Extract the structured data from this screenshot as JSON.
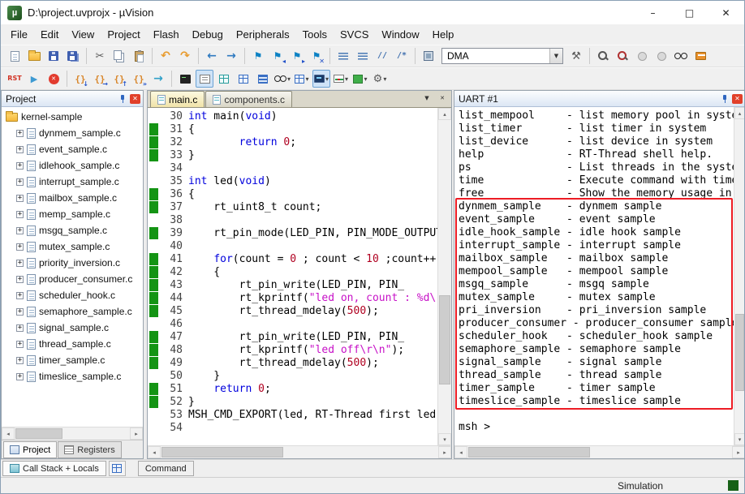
{
  "window": {
    "title": "D:\\project.uvprojx - µVision"
  },
  "menu": {
    "items": [
      "File",
      "Edit",
      "View",
      "Project",
      "Flash",
      "Debug",
      "Peripherals",
      "Tools",
      "SVCS",
      "Window",
      "Help"
    ]
  },
  "icons": {
    "app_logo": "µ",
    "minimize": "–",
    "maximize": "□",
    "close": "✕",
    "dropdown": "▼",
    "dropdown_small": "▾",
    "expander": "+",
    "scroll_left": "◂",
    "scroll_right": "▸",
    "scroll_up": "▴",
    "scroll_down": "▾",
    "tab_menu": "▼",
    "window_close_small": "✕"
  },
  "colors": {
    "annotation_red": "#ed1c24",
    "change_bar_green": "#149414",
    "keyword": "#0000dd",
    "string": "#c710c7",
    "number": "#b00020"
  },
  "toolbar": {
    "target_value": "DMA",
    "row1": [
      {
        "n": "new-file-icon",
        "g": "page"
      },
      {
        "n": "open-file-icon",
        "g": "folder"
      },
      {
        "n": "save-icon",
        "g": "floppy"
      },
      {
        "n": "save-all-icon",
        "g": "floppy2"
      },
      {
        "sep": true
      },
      {
        "n": "cut-icon",
        "g": "cut",
        "ch": "✂"
      },
      {
        "n": "copy-icon",
        "g": "copy"
      },
      {
        "n": "paste-icon",
        "g": "paste"
      },
      {
        "sep": true
      },
      {
        "n": "undo-icon",
        "g": "undo",
        "ch": "↶"
      },
      {
        "n": "redo-icon",
        "g": "redo",
        "ch": "↷"
      },
      {
        "sep": true
      },
      {
        "n": "navigate-back-icon",
        "g": "back",
        "ch": "←"
      },
      {
        "n": "navigate-forward-icon",
        "g": "fwd",
        "ch": "→"
      },
      {
        "sep": true
      },
      {
        "n": "bookmark-toggle-icon",
        "g": "flag",
        "ch": "⚑"
      },
      {
        "n": "bookmark-prev-icon",
        "g": "flag",
        "ch": "⚑",
        "b": "◂"
      },
      {
        "n": "bookmark-next-icon",
        "g": "flag",
        "ch": "⚑",
        "b": "▸"
      },
      {
        "n": "bookmark-clear-icon",
        "g": "flag",
        "ch": "⚑",
        "b": "✕"
      },
      {
        "sep": true
      },
      {
        "n": "unindent-icon",
        "g": "unindent"
      },
      {
        "n": "indent-icon",
        "g": "indent"
      },
      {
        "n": "comment-icon",
        "g": "comment",
        "ch": "//"
      },
      {
        "n": "uncomment-icon",
        "g": "uncomment",
        "ch": "/*"
      },
      {
        "sep": true
      },
      {
        "n": "flash-download-icon",
        "g": "chip"
      },
      {
        "combo": true
      },
      {
        "n": "target-options-icon",
        "g": "wrench",
        "ch": "⚒"
      },
      {
        "sep": true
      },
      {
        "n": "find-in-files-icon",
        "g": "mag"
      },
      {
        "n": "find-icon",
        "g": "magred"
      },
      {
        "n": "run-disabled-icon",
        "g": "circle-dis"
      },
      {
        "n": "stop-disabled-icon",
        "g": "circle-dis"
      },
      {
        "n": "spectacles-icon",
        "g": "glasses"
      },
      {
        "n": "help-books-icon",
        "g": "book"
      }
    ],
    "row2": [
      {
        "n": "reset-icon",
        "g": "rst",
        "ch": "RST"
      },
      {
        "n": "run-icon",
        "g": "run",
        "ch": "▶"
      },
      {
        "n": "stop-icon",
        "g": "stop",
        "ch": "✕"
      },
      {
        "sep": true
      },
      {
        "n": "step-into-icon",
        "g": "step",
        "ch": "{}",
        "b": "↓"
      },
      {
        "n": "step-over-icon",
        "g": "step",
        "ch": "{}",
        "b": "→"
      },
      {
        "n": "step-out-icon",
        "g": "step",
        "ch": "{}",
        "b": "↑"
      },
      {
        "n": "run-to-cursor-icon",
        "g": "step",
        "ch": "{}",
        "b": "»"
      },
      {
        "n": "show-next-statement-icon",
        "g": "nextstmt",
        "ch": "→"
      },
      {
        "sep": true
      },
      {
        "n": "command-window-icon",
        "g": "terminal"
      },
      {
        "n": "disassembly-window-icon",
        "g": "disasm",
        "pressed": true
      },
      {
        "n": "symbol-window-icon",
        "g": "grid-teal"
      },
      {
        "n": "registers-window-icon",
        "g": "grid-blue"
      },
      {
        "n": "call-stack-window-icon",
        "g": "stack"
      },
      {
        "n": "watch-windows-icon",
        "g": "glasses",
        "dd": true
      },
      {
        "n": "memory-windows-icon",
        "g": "grid-blue",
        "dd": true
      },
      {
        "n": "serial-windows-icon",
        "g": "monitor",
        "dd": true,
        "pressed": true
      },
      {
        "n": "analysis-windows-icon",
        "g": "wave",
        "dd": true
      },
      {
        "n": "system-viewer-icon",
        "g": "sysv",
        "dd": true
      },
      {
        "n": "toolbox-icon",
        "g": "gear",
        "ch": "⚙",
        "dd": true
      }
    ]
  },
  "project_panel": {
    "title": "Project",
    "root": "kernel-sample",
    "files": [
      "dynmem_sample.c",
      "event_sample.c",
      "idlehook_sample.c",
      "interrupt_sample.c",
      "mailbox_sample.c",
      "memp_sample.c",
      "msgq_sample.c",
      "mutex_sample.c",
      "priority_inversion.c",
      "producer_consumer.c",
      "scheduler_hook.c",
      "semaphore_sample.c",
      "signal_sample.c",
      "thread_sample.c",
      "timer_sample.c",
      "timeslice_sample.c"
    ],
    "tabs": [
      "Project",
      "Registers"
    ]
  },
  "editor": {
    "tabs": [
      {
        "label": "main.c",
        "active": true
      },
      {
        "label": "components.c",
        "active": false
      }
    ],
    "lines": [
      {
        "no": 30,
        "g": 0,
        "tokens": [
          [
            "k",
            "int"
          ],
          [
            "t",
            " main("
          ],
          [
            "k",
            "void"
          ],
          [
            "t",
            ")"
          ]
        ]
      },
      {
        "no": 31,
        "g": 1,
        "tokens": [
          [
            "t",
            "{"
          ]
        ]
      },
      {
        "no": 32,
        "g": 1,
        "tokens": [
          [
            "t",
            "        "
          ],
          [
            "k",
            "return"
          ],
          [
            "t",
            " "
          ],
          [
            "n",
            "0"
          ],
          [
            "t",
            ";"
          ]
        ]
      },
      {
        "no": 33,
        "g": 1,
        "tokens": [
          [
            "t",
            "}"
          ]
        ]
      },
      {
        "no": 34,
        "g": 0,
        "tokens": []
      },
      {
        "no": 35,
        "g": 0,
        "tokens": [
          [
            "k",
            "int"
          ],
          [
            "t",
            " led("
          ],
          [
            "k",
            "void"
          ],
          [
            "t",
            ")"
          ]
        ]
      },
      {
        "no": 36,
        "g": 1,
        "tokens": [
          [
            "t",
            "{"
          ]
        ]
      },
      {
        "no": 37,
        "g": 1,
        "tokens": [
          [
            "t",
            "    rt_uint8_t count;"
          ]
        ]
      },
      {
        "no": 38,
        "g": 0,
        "tokens": []
      },
      {
        "no": 39,
        "g": 1,
        "tokens": [
          [
            "t",
            "    rt_pin_mode(LED_PIN, PIN_MODE_OUTPUT);"
          ]
        ]
      },
      {
        "no": 40,
        "g": 0,
        "tokens": []
      },
      {
        "no": 41,
        "g": 1,
        "tokens": [
          [
            "t",
            "    "
          ],
          [
            "k",
            "for"
          ],
          [
            "t",
            "(count = "
          ],
          [
            "n",
            "0"
          ],
          [
            "t",
            " ; count < "
          ],
          [
            "n",
            "10"
          ],
          [
            "t",
            " ;count++)"
          ]
        ]
      },
      {
        "no": 42,
        "g": 1,
        "tokens": [
          [
            "t",
            "    {"
          ]
        ]
      },
      {
        "no": 43,
        "g": 1,
        "tokens": [
          [
            "t",
            "        rt_pin_write(LED_PIN, PIN_"
          ]
        ]
      },
      {
        "no": 44,
        "g": 1,
        "tokens": [
          [
            "t",
            "        rt_kprintf("
          ],
          [
            "s",
            "\"led on, count : %d\\r\\n\""
          ],
          [
            "t",
            ", count);"
          ]
        ]
      },
      {
        "no": 45,
        "g": 1,
        "tokens": [
          [
            "t",
            "        rt_thread_mdelay("
          ],
          [
            "n",
            "500"
          ],
          [
            "t",
            ");"
          ]
        ]
      },
      {
        "no": 46,
        "g": 0,
        "tokens": []
      },
      {
        "no": 47,
        "g": 1,
        "tokens": [
          [
            "t",
            "        rt_pin_write(LED_PIN, PIN_"
          ]
        ]
      },
      {
        "no": 48,
        "g": 1,
        "tokens": [
          [
            "t",
            "        rt_kprintf("
          ],
          [
            "s",
            "\"led off\\r\\n\""
          ],
          [
            "t",
            ");"
          ]
        ]
      },
      {
        "no": 49,
        "g": 1,
        "tokens": [
          [
            "t",
            "        rt_thread_mdelay("
          ],
          [
            "n",
            "500"
          ],
          [
            "t",
            ");"
          ]
        ]
      },
      {
        "no": 50,
        "g": 0,
        "tokens": [
          [
            "t",
            "    }"
          ]
        ]
      },
      {
        "no": 51,
        "g": 1,
        "tokens": [
          [
            "t",
            "    "
          ],
          [
            "k",
            "return"
          ],
          [
            "t",
            " "
          ],
          [
            "n",
            "0"
          ],
          [
            "t",
            ";"
          ]
        ]
      },
      {
        "no": 52,
        "g": 1,
        "tokens": [
          [
            "t",
            "}"
          ]
        ]
      },
      {
        "no": 53,
        "g": 0,
        "tokens": [
          [
            "t",
            "MSH_CMD_EXPORT(led, RT-Thread first led sample);"
          ]
        ]
      },
      {
        "no": 54,
        "g": 0,
        "tokens": []
      }
    ]
  },
  "uart_panel": {
    "title": "UART #1",
    "lines": [
      "list_mempool     - list memory pool in system",
      "list_timer       - list timer in system",
      "list_device      - list device in system",
      "help             - RT-Thread shell help.",
      "ps               - List threads in the system.",
      "time             - Execute command with time.",
      "free             - Show the memory usage in the system.",
      "dynmem_sample    - dynmem sample",
      "event_sample     - event sample",
      "idle_hook_sample - idle hook sample",
      "interrupt_sample - interrupt sample",
      "mailbox_sample   - mailbox sample",
      "mempool_sample   - mempool sample",
      "msgq_sample      - msgq sample",
      "mutex_sample     - mutex sample",
      "pri_inversion    - pri_inversion sample",
      "producer_consumer - producer_consumer sample",
      "scheduler_hook   - scheduler_hook sample",
      "semaphore_sample - semaphore sample",
      "signal_sample    - signal sample",
      "thread_sample    - thread sample",
      "timer_sample     - timer sample",
      "timeslice_sample - timeslice sample"
    ],
    "prompt": "msh >",
    "highlight": {
      "start": 7,
      "end": 22
    }
  },
  "bottom": {
    "call_stack_label": "Call Stack + Locals",
    "command_label": "Command"
  },
  "status": {
    "mode": "Simulation"
  }
}
